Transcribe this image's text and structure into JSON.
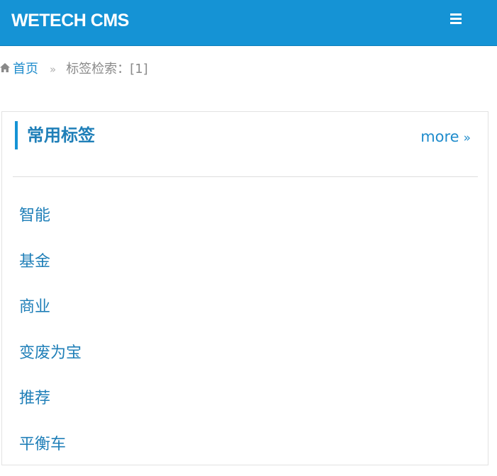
{
  "header": {
    "brand": "WETECH CMS",
    "menu_icon": "hamburger-menu-icon",
    "background_color": "#1593d5"
  },
  "breadcrumb": {
    "home_icon": "home-icon",
    "home_label": "首页",
    "separator": "»",
    "current_label": "标签检索：[1]"
  },
  "panel": {
    "title": "常用标签",
    "more_label": "more",
    "more_arrow": "»",
    "accent_color": "#1593d5",
    "tags": [
      "智能",
      "基金",
      "商业",
      "变废为宝",
      "推荐",
      "平衡车"
    ]
  }
}
